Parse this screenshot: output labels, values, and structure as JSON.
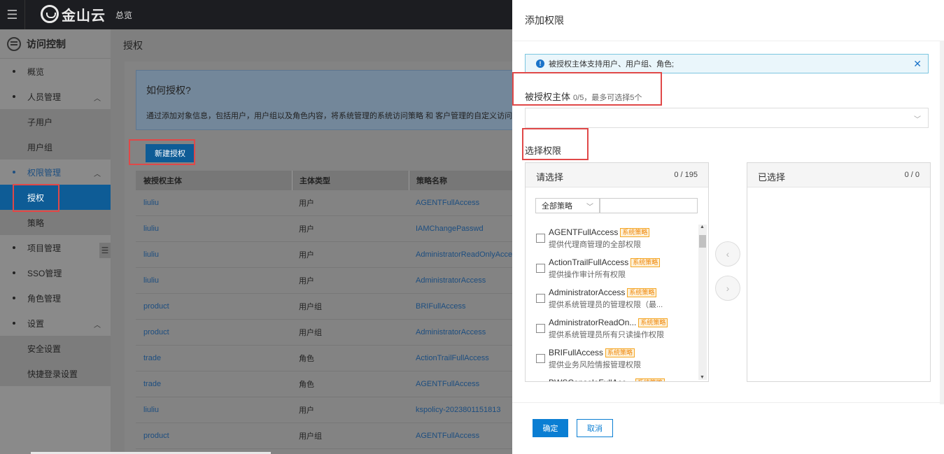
{
  "topbar": {
    "menu_icon": "hamburger-icon",
    "logo_text": "金山云",
    "overview": "总览"
  },
  "sidebar": {
    "title": "访问控制",
    "items": [
      {
        "label": "概览"
      },
      {
        "label": "人员管理"
      },
      {
        "label": "子用户"
      },
      {
        "label": "用户组"
      },
      {
        "label": "权限管理"
      },
      {
        "label": "授权"
      },
      {
        "label": "策略"
      },
      {
        "label": "项目管理"
      },
      {
        "label": "SSO管理"
      },
      {
        "label": "角色管理"
      },
      {
        "label": "设置"
      },
      {
        "label": "安全设置"
      },
      {
        "label": "快捷登录设置"
      }
    ]
  },
  "main": {
    "title": "授权",
    "info_title": "如何授权?",
    "info_desc": "通过添加对象信息，包括用户，用户组以及角色内容，将系统管理的系统访问策略 和 客户管理的自定义访问策",
    "new_button": "新建授权",
    "columns": [
      "被授权主体",
      "主体类型",
      "策略名称"
    ],
    "rows": [
      [
        "liuliu",
        "用户",
        "AGENTFullAccess"
      ],
      [
        "liuliu",
        "用户",
        "IAMChangePasswd"
      ],
      [
        "liuliu",
        "用户",
        "AdministratorReadOnlyAccess"
      ],
      [
        "liuliu",
        "用户",
        "AdministratorAccess"
      ],
      [
        "product",
        "用户组",
        "BRIFullAccess"
      ],
      [
        "product",
        "用户组",
        "AdministratorAccess"
      ],
      [
        "trade",
        "角色",
        "ActionTrailFullAccess"
      ],
      [
        "trade",
        "角色",
        "AGENTFullAccess"
      ],
      [
        "liuliu",
        "用户",
        "kspolicy-2023801151813"
      ],
      [
        "product",
        "用户组",
        "AGENTFullAccess"
      ]
    ]
  },
  "drawer": {
    "title": "添加权限",
    "alert": "被授权主体支持用户、用户组、角色;",
    "principal_label": "被授权主体",
    "principal_hint": "0/5，最多可选择5个",
    "permission_label": "选择权限",
    "left_panel": {
      "title": "请选择",
      "count": "0 / 195",
      "filter": "全部策略",
      "policies": [
        {
          "name": "AGENTFullAccess",
          "tag": "系统策略",
          "desc": "提供代理商管理的全部权限"
        },
        {
          "name": "ActionTrailFullAccess",
          "tag": "系统策略",
          "desc": "提供操作审计所有权限"
        },
        {
          "name": "AdministratorAccess",
          "tag": "系统策略",
          "desc": "提供系统管理员的管理权限（最..."
        },
        {
          "name": "AdministratorReadOn...",
          "tag": "系统策略",
          "desc": "提供系统管理员所有只读操作权限"
        },
        {
          "name": "BRIFullAccess",
          "tag": "系统策略",
          "desc": "提供业务风险情报管理权限"
        },
        {
          "name": "BWSConsoleFullAcc...",
          "tag": "系统策略",
          "desc": ""
        }
      ]
    },
    "right_panel": {
      "title": "已选择",
      "count": "0 / 0"
    },
    "ok_button": "确定",
    "cancel_button": "取消"
  }
}
